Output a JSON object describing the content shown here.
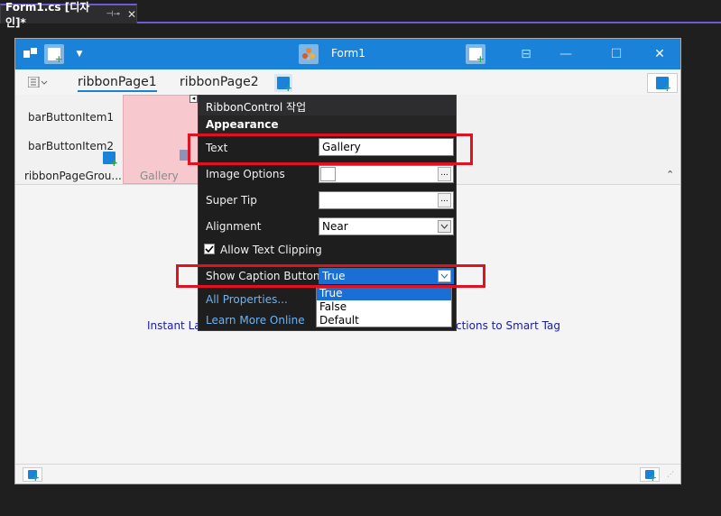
{
  "doc_tab": {
    "title": "Form1.cs [디자인]*",
    "pin_glyph": "⊣⊸",
    "close_glyph": "✕"
  },
  "form": {
    "title": "Form1",
    "window_controls": [
      "⊟",
      "—",
      "☐",
      "✕"
    ],
    "ribbon_tabs": [
      "ribbonPage1",
      "ribbonPage2"
    ],
    "bar_items": [
      "barButtonItem1",
      "barButtonItem2"
    ],
    "group_caption": "ribbonPageGrou...",
    "gallery_caption": "Gallery",
    "hint_left": "Instant La",
    "hint_right": "ctions to Smart Tag"
  },
  "panel": {
    "header": "RibbonControl 작업",
    "section": "Appearance",
    "text_label": "Text",
    "text_value": "Gallery",
    "image_options_label": "Image Options",
    "super_tip_label": "Super Tip",
    "alignment_label": "Alignment",
    "alignment_value": "Near",
    "allow_clipping_label": "Allow Text Clipping",
    "allow_clipping_checked": true,
    "show_caption_label": "Show Caption Button",
    "show_caption_value": "True",
    "show_caption_options": [
      "True",
      "False",
      "Default"
    ],
    "all_properties": "All Properties...",
    "learn_more": "Learn More Online",
    "ellipsis": "..."
  },
  "colors": {
    "accent": "#1a82d9",
    "highlight_red": "#e0121f",
    "gallery_pink": "#f7c9cf",
    "link_blue": "#6cb4f5"
  }
}
